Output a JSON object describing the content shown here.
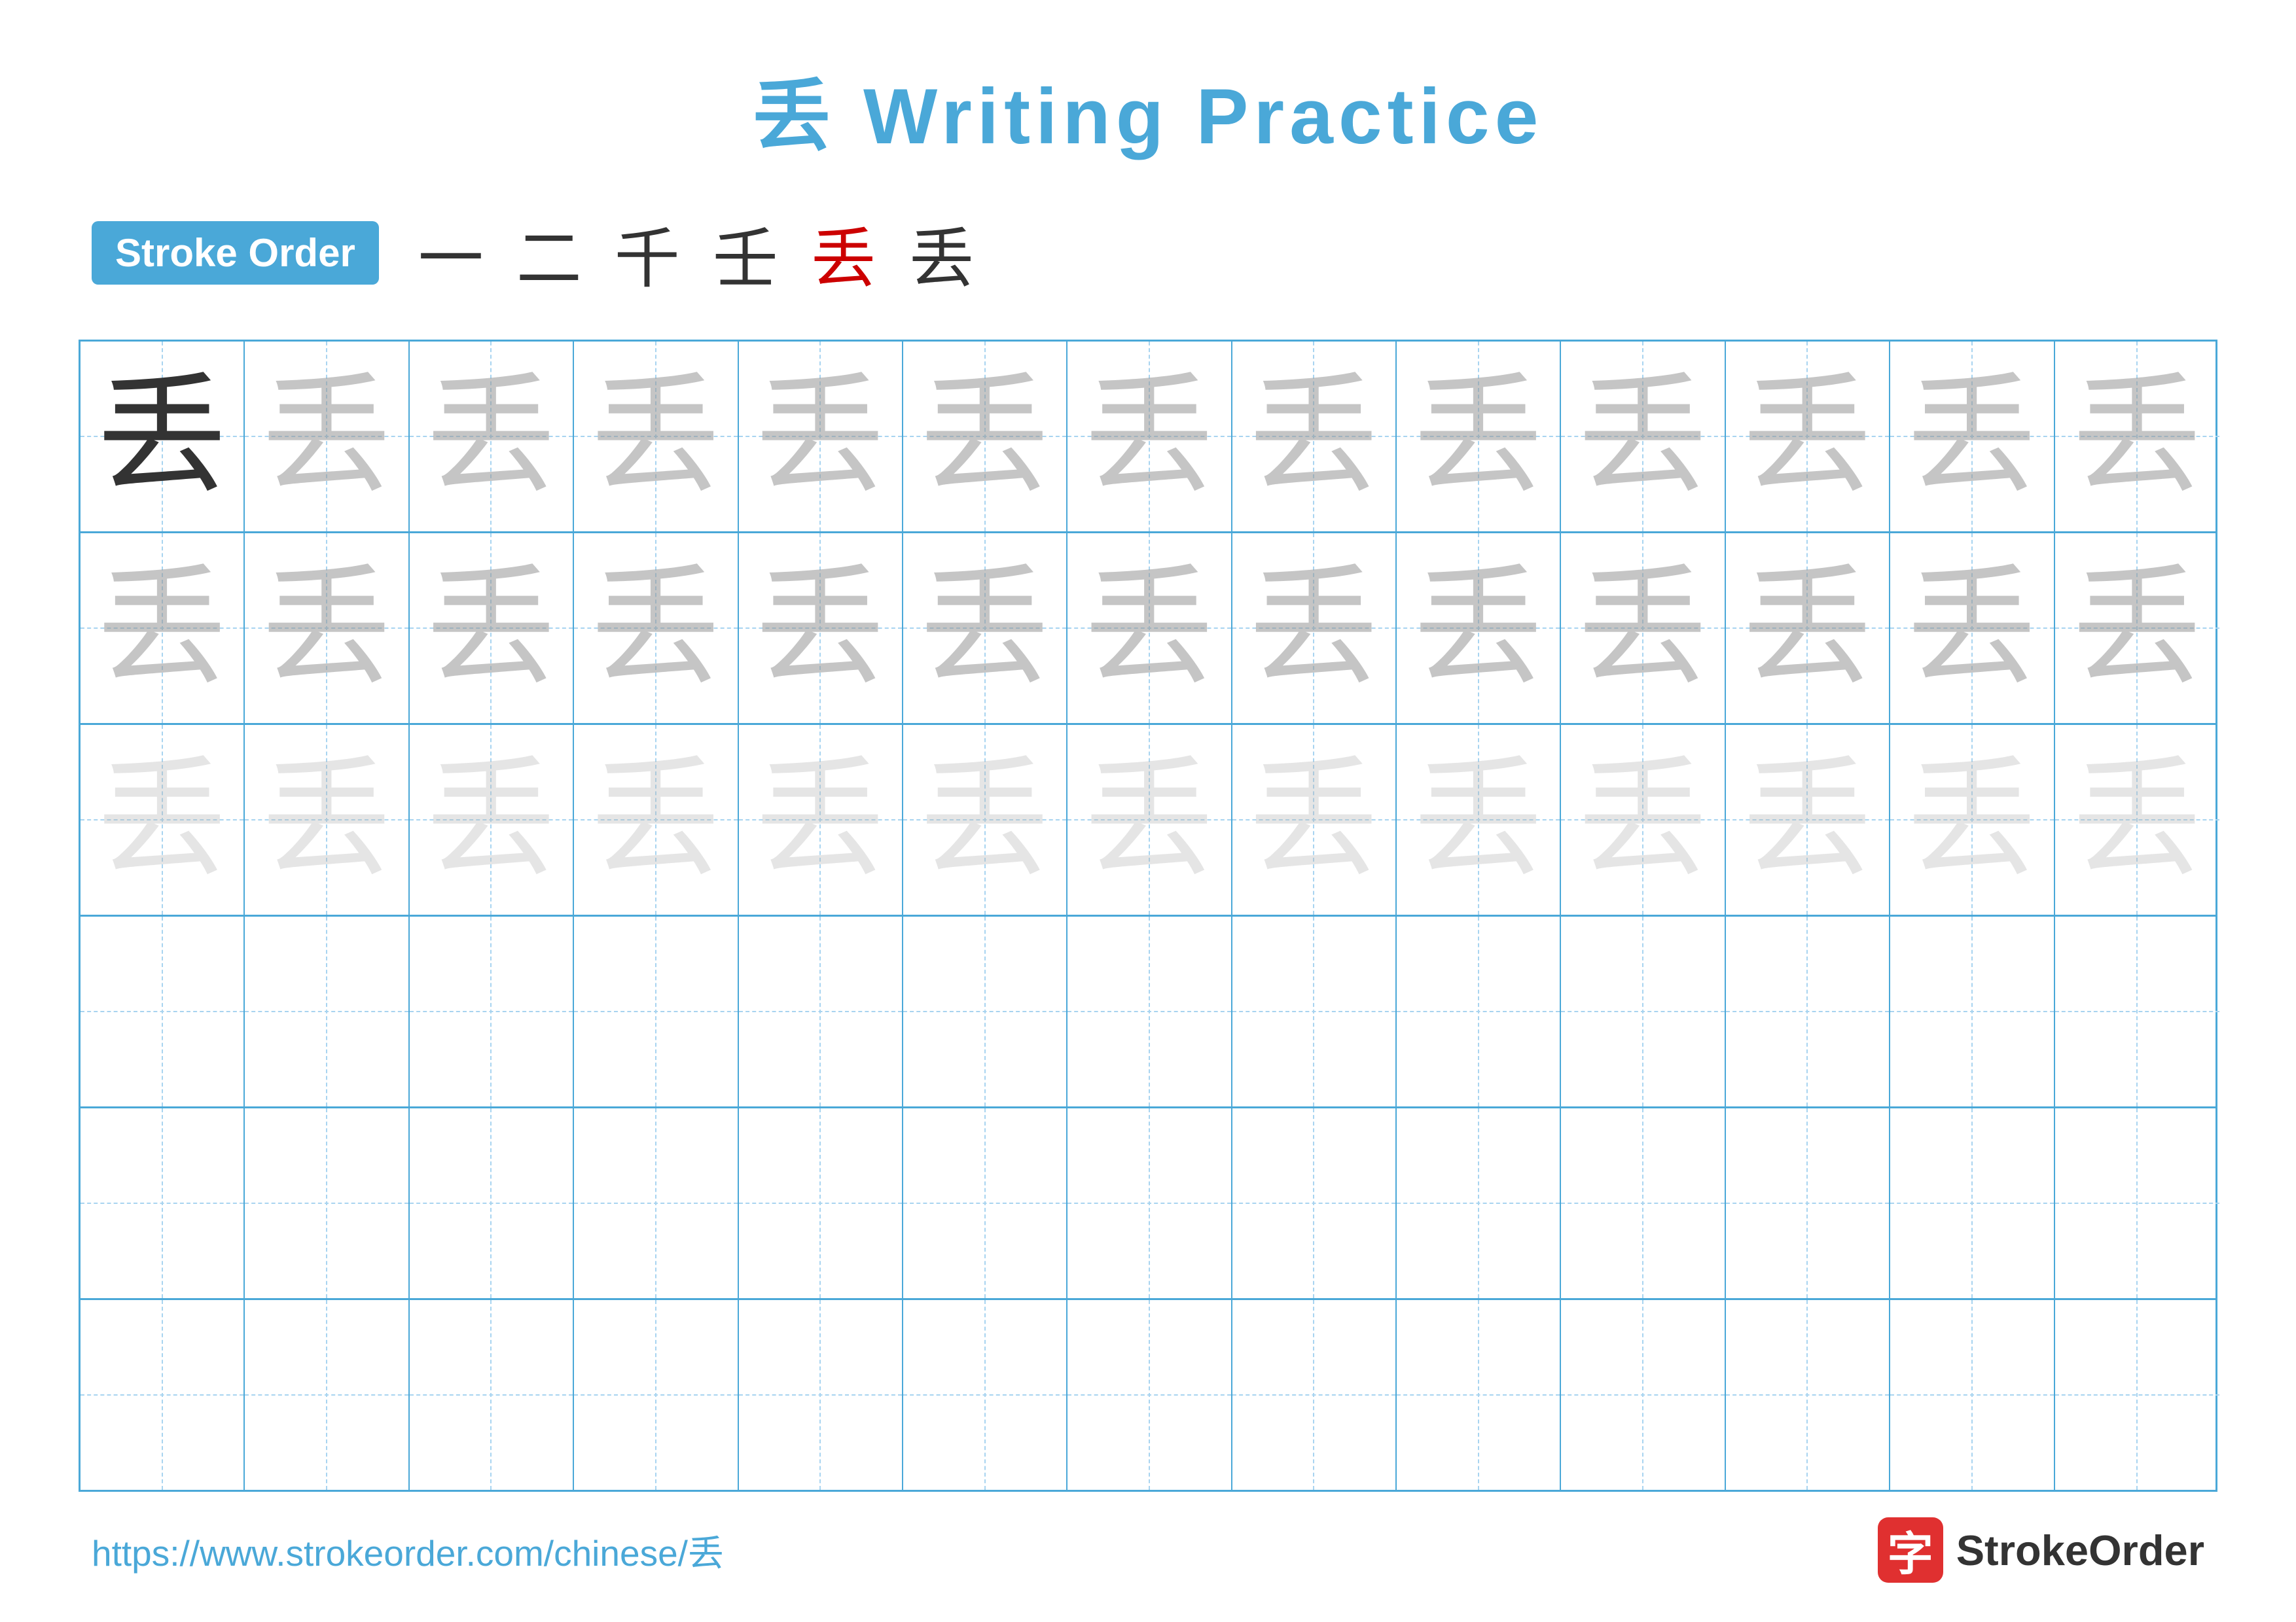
{
  "title": {
    "char": "丢",
    "text": "Writing Practice",
    "full": "丢 Writing Practice"
  },
  "stroke_order": {
    "badge_label": "Stroke Order",
    "strokes": [
      "一",
      "二",
      "千",
      "壬",
      "丢̲",
      "丢"
    ]
  },
  "grid": {
    "rows": 6,
    "cols": 13,
    "char": "丢",
    "row_configs": [
      {
        "type": "dark_then_medium",
        "dark_count": 1
      },
      {
        "type": "alternating_medium"
      },
      {
        "type": "light_all"
      },
      {
        "type": "empty"
      },
      {
        "type": "empty"
      },
      {
        "type": "empty"
      }
    ]
  },
  "footer": {
    "url": "https://www.strokeorder.com/chinese/丢",
    "logo_char": "字",
    "logo_text": "StrokeOrder"
  },
  "colors": {
    "accent": "#4aa8d8",
    "dark_char": "#333333",
    "medium_char": "rgba(150,150,150,0.55)",
    "light_char": "rgba(180,180,180,0.35)",
    "red": "#cc0000",
    "grid_line": "#4aa8d8",
    "dashed_line": "#a8d4f0"
  }
}
